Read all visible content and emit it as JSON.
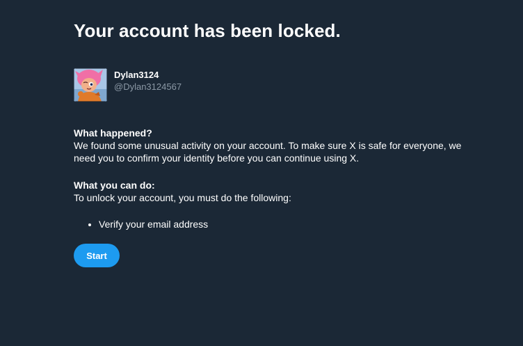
{
  "page": {
    "title": "Your account has been locked."
  },
  "profile": {
    "display_name": "Dylan3124",
    "handle": "@Dylan3124567"
  },
  "what_happened": {
    "heading": "What happened?",
    "body": "We found some unusual activity on your account. To make sure X is safe for everyone, we need you to confirm your identity before you can continue using X."
  },
  "what_you_can_do": {
    "heading": "What you can do:",
    "body": "To unlock your account, you must do the following:",
    "steps": [
      "Verify your email address"
    ]
  },
  "actions": {
    "start_label": "Start"
  },
  "colors": {
    "background": "#1b2836",
    "primary_button": "#1d9bf0",
    "secondary_text": "#8b98a5"
  }
}
